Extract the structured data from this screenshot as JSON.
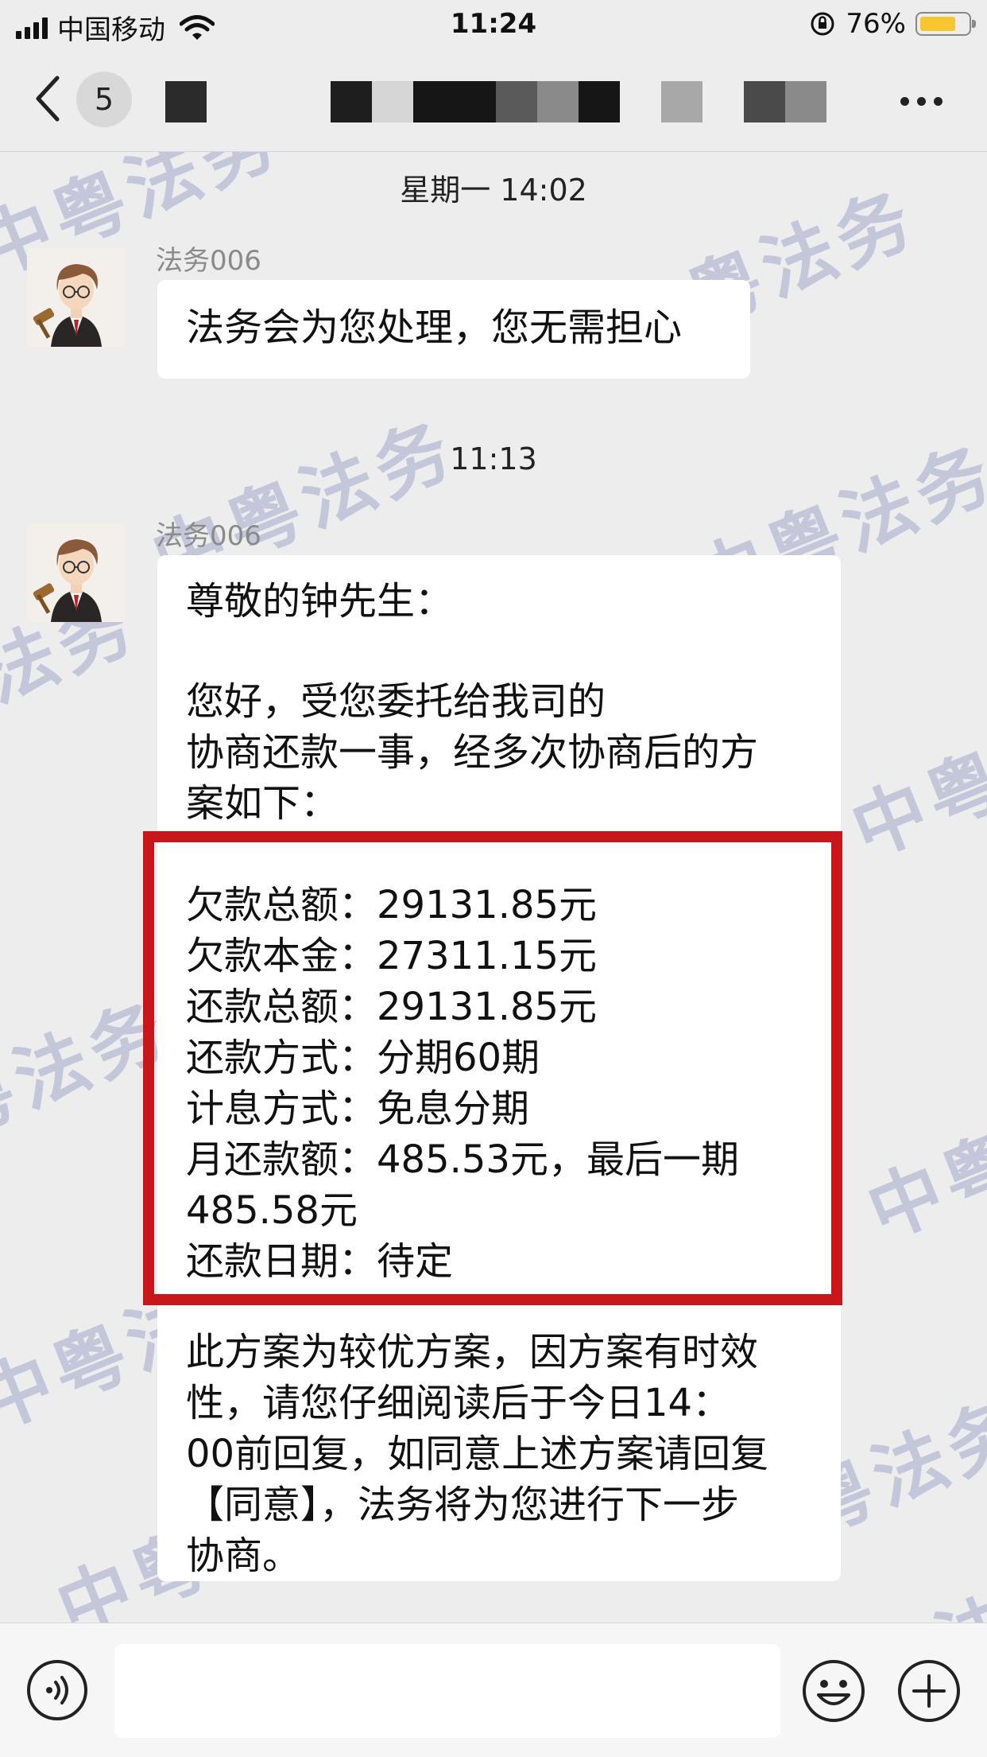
{
  "status_bar": {
    "carrier": "中国移动",
    "time": "11:24",
    "battery_percent_text": "76%",
    "battery_level": 0.76
  },
  "nav": {
    "unread_count": "5"
  },
  "watermark_text": "中粤法务",
  "messages": [
    {
      "time_label": "星期一 14:02",
      "sender": "法务006",
      "text": "法务会为您处理，您无需担心"
    },
    {
      "time_label": "11:13",
      "sender": "法务006",
      "greeting": "尊敬的钟先生：",
      "intro": "您好，受您委托给我司的\n协商还款一事，经多次协商后的方\n案如下：",
      "plan_lines": [
        "欠款总额：29131.85元",
        "欠款本金：27311.15元",
        "还款总额：29131.85元",
        "还款方式：分期60期",
        "计息方式：免息分期",
        "月还款额：485.53元，最后一期",
        "485.58元",
        "还款日期：待定"
      ],
      "closing": "此方案为较优方案，因方案有时效\n性，请您仔细阅读后于今日14：\n00前回复，如同意上述方案请回复\n【同意】，法务将为您进行下一步\n协商。"
    }
  ],
  "colors": {
    "highlight_border": "#c8171b",
    "battery_fill": "#f7c630",
    "background": "#ededed"
  }
}
